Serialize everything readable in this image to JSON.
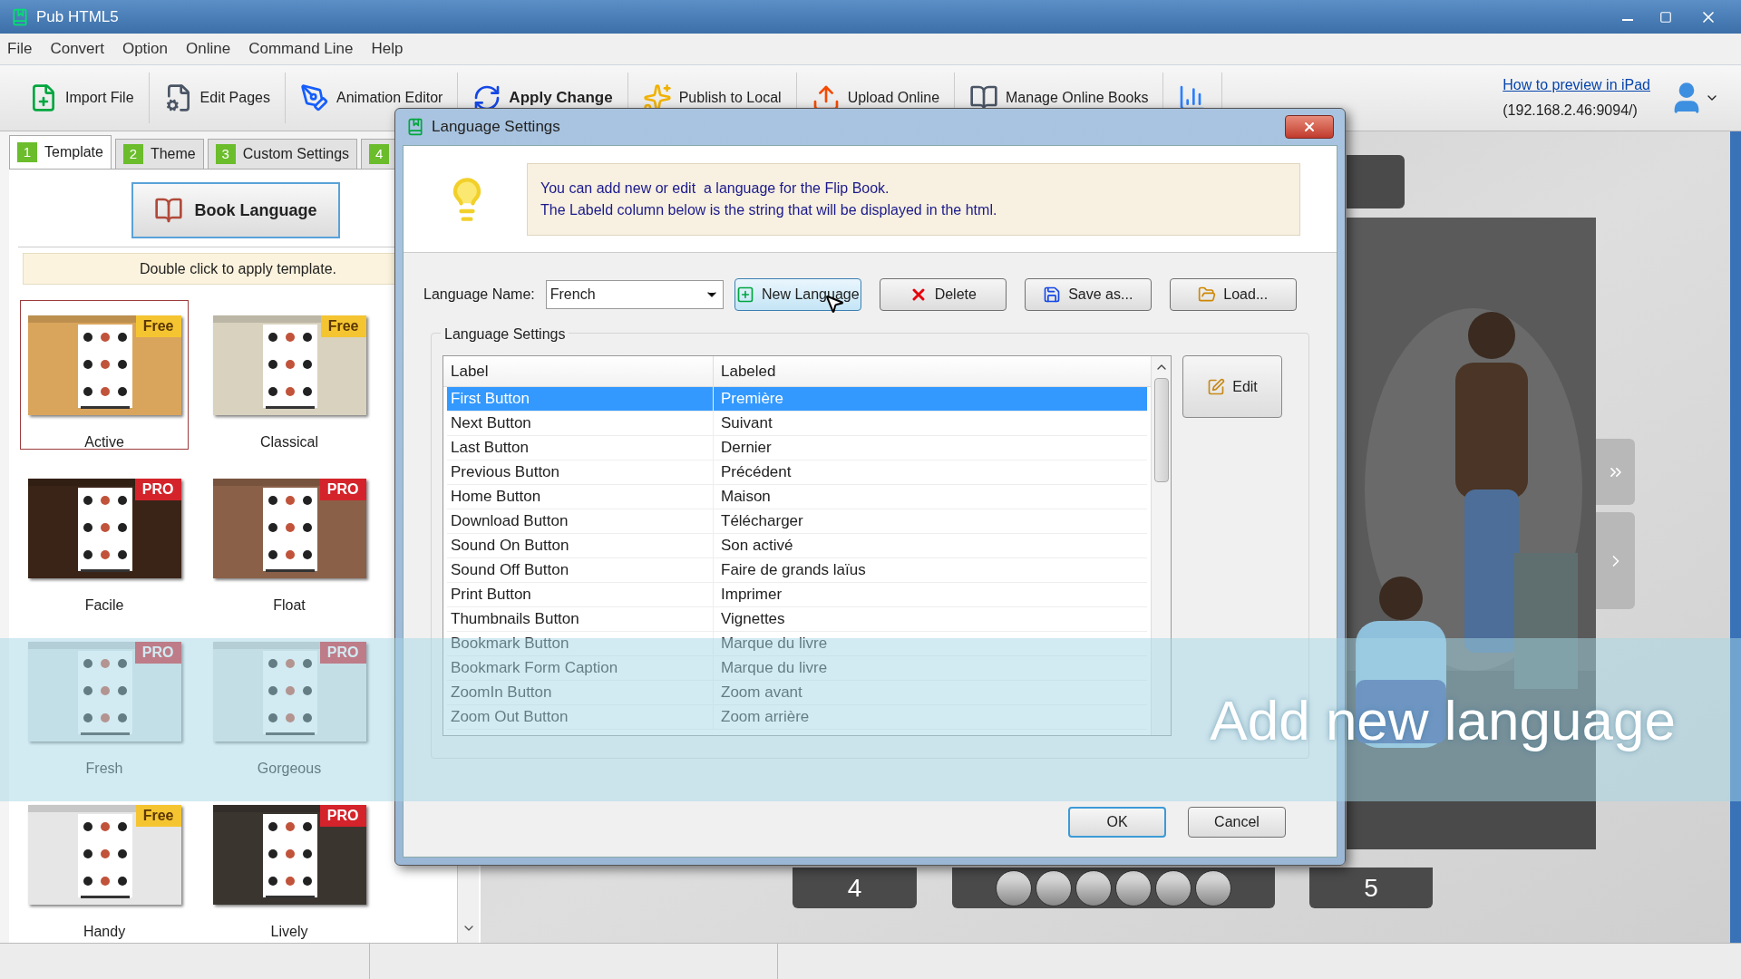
{
  "window": {
    "title": "Pub HTML5"
  },
  "menu": [
    "File",
    "Convert",
    "Option",
    "Online",
    "Command Line",
    "Help"
  ],
  "toolbar": [
    {
      "label": "Import File",
      "kind": "import",
      "bold": false
    },
    {
      "label": "Edit Pages",
      "kind": "edit",
      "bold": false
    },
    {
      "label": "Animation Editor",
      "kind": "animation",
      "bold": false
    },
    {
      "label": "Apply Change",
      "kind": "apply",
      "bold": true
    },
    {
      "label": "Publish to Local",
      "kind": "publish",
      "bold": false
    },
    {
      "label": "Upload Online",
      "kind": "upload",
      "bold": false
    },
    {
      "label": "Manage Online Books",
      "kind": "manage",
      "bold": false
    },
    {
      "kind": "chart"
    }
  ],
  "preview_help": {
    "link": "How to preview in iPad",
    "address": "(192.168.2.46:9094/)"
  },
  "tabs": [
    {
      "number": "1",
      "label": "Template",
      "selected": true
    },
    {
      "number": "2",
      "label": "Theme",
      "selected": false
    },
    {
      "number": "3",
      "label": "Custom Settings",
      "selected": false
    },
    {
      "number": "4",
      "selected": false
    }
  ],
  "template_panel": {
    "button": "Book Language",
    "hint": "Double click to apply template.",
    "templates": [
      {
        "name": "Active",
        "badge": "Free",
        "kind": "free",
        "selected": true
      },
      {
        "name": "Classical",
        "badge": "Free",
        "kind": "free",
        "selected": false
      },
      {
        "name": "Facile",
        "badge": "PRO",
        "kind": "pro",
        "selected": false
      },
      {
        "name": "Float",
        "badge": "PRO",
        "kind": "pro",
        "selected": false
      },
      {
        "name": "Fresh",
        "badge": "PRO",
        "kind": "pro",
        "selected": false
      },
      {
        "name": "Gorgeous",
        "badge": "PRO",
        "kind": "pro",
        "selected": false
      },
      {
        "name": "Handy",
        "badge": "Free",
        "kind": "free",
        "selected": false
      },
      {
        "name": "Lively",
        "badge": "PRO",
        "kind": "pro",
        "selected": false
      }
    ]
  },
  "preview": {
    "page_numbers": [
      "4",
      "5"
    ]
  },
  "dialog": {
    "title": "Language Settings",
    "info": [
      "You can add new or edit  a language for the Flip Book.",
      "The Labeld column below is the string that will be displayed in the html."
    ],
    "language_name": {
      "label": "Language Name:",
      "value": "French"
    },
    "buttons": [
      {
        "label": "New Language",
        "kind": "new",
        "hovered": true
      },
      {
        "label": "Delete",
        "kind": "delete",
        "hovered": false
      },
      {
        "label": "Save as...",
        "kind": "save",
        "hovered": false
      },
      {
        "label": "Load...",
        "kind": "load",
        "hovered": false
      }
    ],
    "group_title": "Language Settings",
    "table": {
      "columns": [
        "Label",
        "Labeled"
      ],
      "rows": [
        {
          "label": "First Button",
          "labeled": "Première",
          "selected": true
        },
        {
          "label": "Next Button",
          "labeled": "Suivant",
          "selected": false
        },
        {
          "label": "Last Button",
          "labeled": "Dernier",
          "selected": false
        },
        {
          "label": "Previous Button",
          "labeled": "Précédent",
          "selected": false
        },
        {
          "label": "Home Button",
          "labeled": "Maison",
          "selected": false
        },
        {
          "label": "Download Button",
          "labeled": "Télécharger",
          "selected": false
        },
        {
          "label": "Sound On Button",
          "labeled": "Son activé",
          "selected": false
        },
        {
          "label": "Sound Off Button",
          "labeled": "Faire de grands laïus",
          "selected": false
        },
        {
          "label": "Print Button",
          "labeled": "Imprimer",
          "selected": false
        },
        {
          "label": "Thumbnails Button",
          "labeled": "Vignettes",
          "selected": false
        },
        {
          "label": "Bookmark Button",
          "labeled": "Marque du livre",
          "selected": false
        },
        {
          "label": "Bookmark Form Caption",
          "labeled": "Marque du livre",
          "selected": false
        },
        {
          "label": "ZoomIn Button",
          "labeled": "Zoom avant",
          "selected": false
        },
        {
          "label": "Zoom Out Button",
          "labeled": "Zoom arrière",
          "selected": false
        }
      ]
    },
    "edit_button": "Edit",
    "footer_buttons": [
      {
        "label": "OK",
        "default": true
      },
      {
        "label": "Cancel",
        "default": false
      }
    ]
  },
  "caption": "Add new language"
}
